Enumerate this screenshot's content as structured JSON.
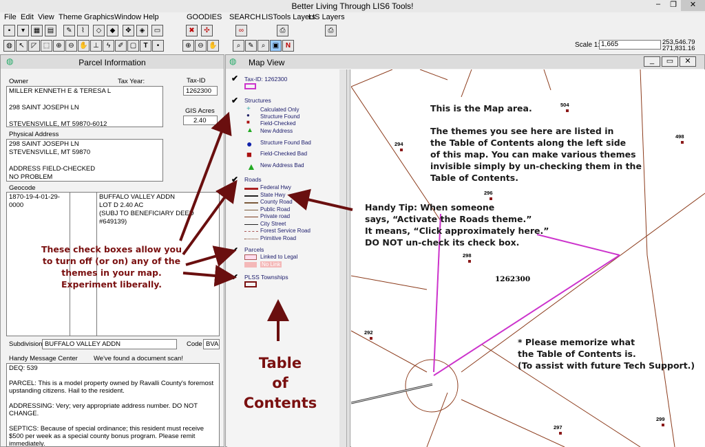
{
  "app": {
    "title": "Better Living Through LIS6 Tools!",
    "menus": [
      "File",
      "Edit",
      "View",
      "Theme",
      "Graphics",
      "Window",
      "Help"
    ],
    "extra_menus": [
      "GOODIES",
      "SEARCH",
      "LISTools Layers",
      "LIS  Layers"
    ],
    "scale_label": "Scale 1:",
    "scale_value": "1,665",
    "coord_x": "253,546.79",
    "coord_y": "271,831.16"
  },
  "parcel": {
    "title": "Parcel Information",
    "owner_label": "Owner",
    "taxyear_label": "Tax Year:",
    "taxid_label": "Tax-ID",
    "taxid_value": "1262300",
    "owner_value": "MILLER KENNETH E & TERESA L\n\n298 SAINT JOSEPH LN\n\nSTEVENSVILLE, MT  59870-6012",
    "gis_acres_label": "GIS Acres",
    "gis_acres_value": "2.40",
    "physical_label": "Physical Address",
    "physical_value": "298 SAINT JOSEPH LN\nSTEVENSVILLE, MT  59870\n\nADDRESS FIELD-CHECKED\nNO PROBLEM",
    "geocode_label": "Geocode",
    "geocode_value": "1870-19-4-01-29-0000",
    "legal_value": "BUFFALO VALLEY ADDN\nLOT D      2.40 AC\n(SUBJ TO BENEFICIARY DEED\n#649139)",
    "subdivision_label": "Subdivision",
    "subdivision_value": "BUFFALO VALLEY ADDN",
    "code_label": "Code",
    "code_value": "BVA",
    "message_label": "Handy Message Center",
    "message_status": "We've found a document scan!",
    "messages": "DEQ:  539\n\nPARCEL:  This is a model property owned by Ravalli County's foremost upstanding citizens.  Hail to the resident.\n\nADDRESSING:  Very; very appropriate address number.  DO NOT CHANGE.\n\nSEPTICS:  Because of special ordinance; this resident must receive $500 per week as a special county bonus program.  Please remit immediately."
  },
  "map": {
    "title": "Map View",
    "toc": {
      "taxid": "Tax-ID: 1262300",
      "structures": "Structures",
      "structure_items": [
        "Calculated Only",
        "Structure Found",
        "Field-Checked",
        "New Address",
        "Structure Found Bad",
        "Field-Checked Bad",
        "New Address Bad"
      ],
      "roads": "Roads",
      "road_items": [
        "Federal Hwy",
        "State Hwy",
        "County Road",
        "Public Road",
        "Private road",
        "City Street",
        "Forest Service Road",
        "Primitive Road"
      ],
      "parcels": "Parcels",
      "parcel_items": [
        "Linked to Legal",
        "No Link"
      ],
      "plss": "PLSS Townships"
    },
    "parcel_numbers": [
      "504",
      "498",
      "294",
      "296",
      "298",
      "292",
      "297",
      "299"
    ],
    "selected_parcel": "1262300"
  },
  "annotations": {
    "map_area": "This is the Map area.",
    "themes_text": "The themes you see here are listed in\nthe Table of Contents along the left side\nof this map.  You can make various themes\ninvisible simply by un-checking them in the\nTable of Contents.",
    "tip_text": "Handy Tip:  When someone\nsays, “Activate the Roads theme.”\nIt means, “Click approximately here.”\nDO NOT un-check its check box.",
    "checkbox_text": "These check boxes allow you\nto turn off (or on) any of the\nthemes in your map.\nExperiment liberally.",
    "memorize_text": "* Please memorize what\nthe Table of Contents is.\n(To assist with future Tech Support.)",
    "toc_label": "Table\nof\nContents"
  }
}
